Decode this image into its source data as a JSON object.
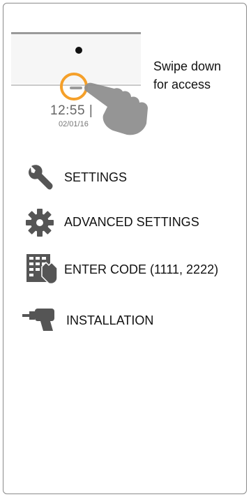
{
  "instruction": {
    "swipe_line1": "Swipe down",
    "swipe_line2": "for access"
  },
  "device_preview": {
    "time": "12:55 |",
    "date": "02/01/16"
  },
  "menu": [
    {
      "label": "SETTINGS",
      "icon": "wrench-icon"
    },
    {
      "label": "ADVANCED SETTINGS",
      "icon": "gear-icon"
    },
    {
      "label": "ENTER CODE (1111, 2222)",
      "icon": "keypad-hand-icon"
    },
    {
      "label": "INSTALLATION",
      "icon": "drill-icon"
    }
  ],
  "colors": {
    "accent_ring": "#f5a02a",
    "icon_gray": "#555555"
  }
}
